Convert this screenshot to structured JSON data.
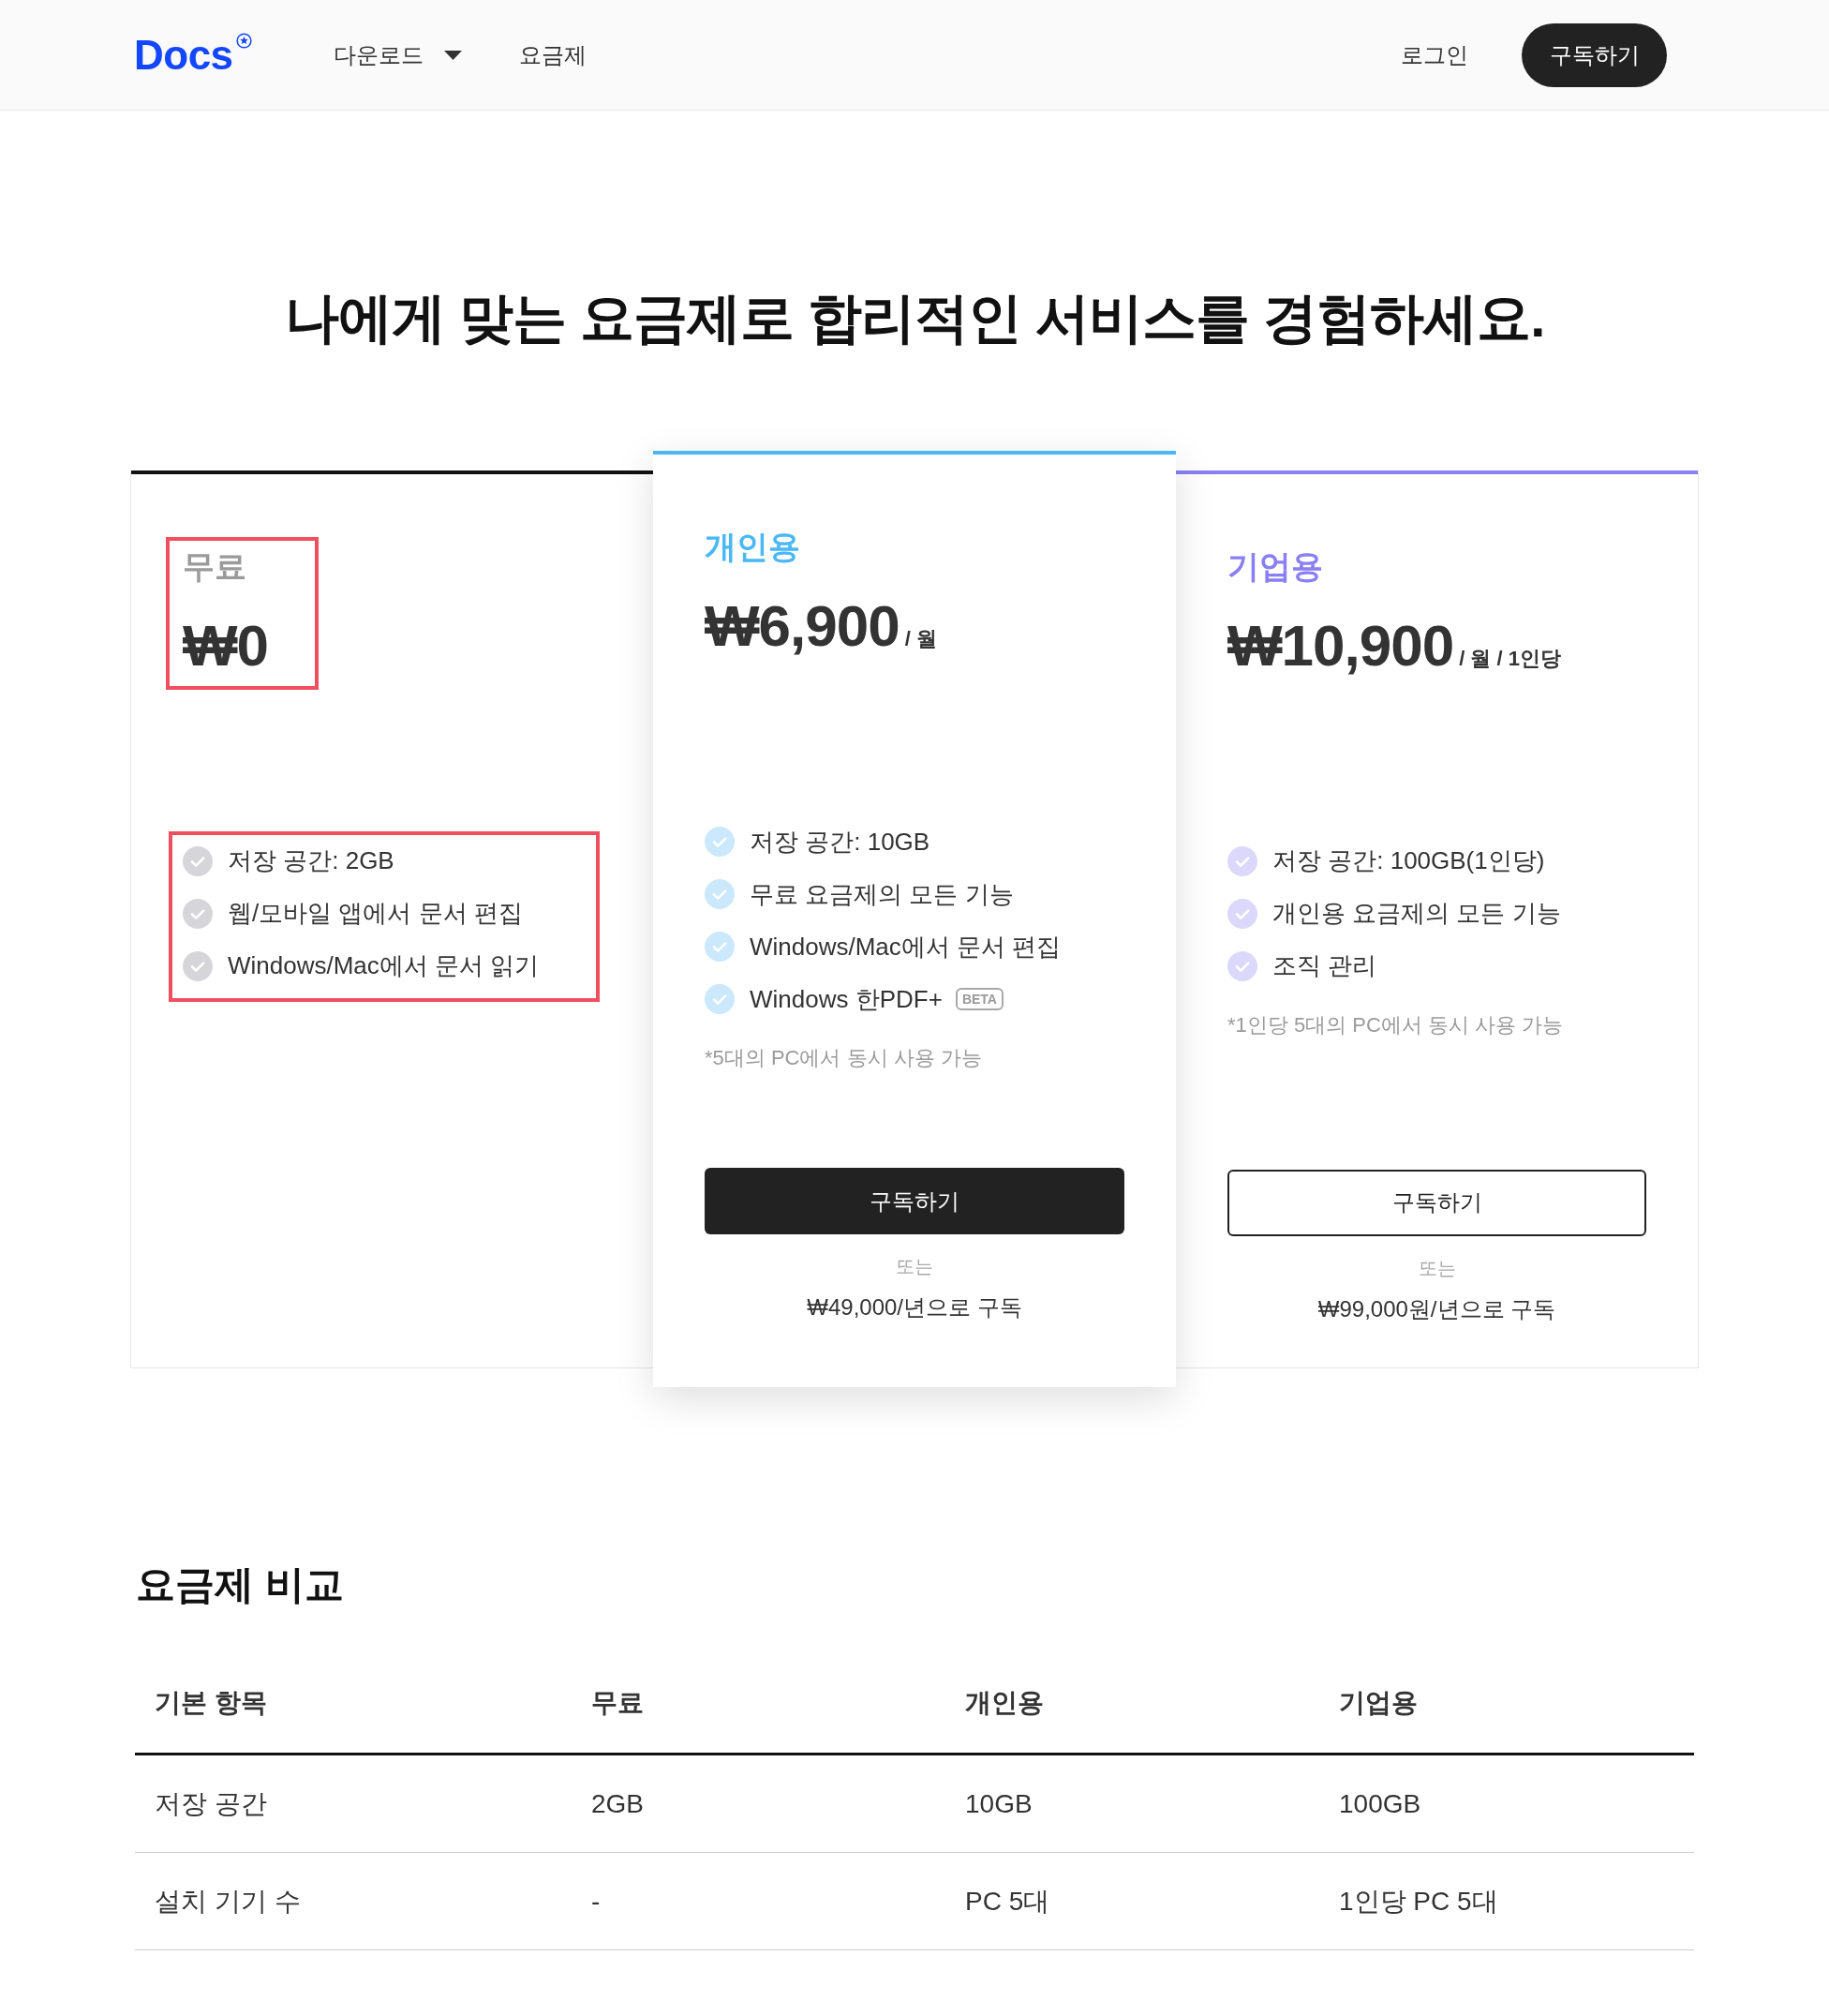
{
  "header": {
    "logo": "Docs",
    "nav": [
      {
        "label": "다운로드",
        "dropdown": true
      },
      {
        "label": "요금제",
        "dropdown": false
      }
    ],
    "login": "로그인",
    "subscribe": "구독하기"
  },
  "headline": "나에게 맞는 요금제로 합리적인 서비스를 경험하세요.",
  "plans": [
    {
      "kind": "free",
      "color": "#111111",
      "name": "무료",
      "price": "₩0",
      "header_highlighted": true,
      "features_highlighted": true,
      "features": [
        {
          "text": "저장 공간: 2GB"
        },
        {
          "text": "웹/모바일 앱에서 문서 편집"
        },
        {
          "text": "Windows/Mac에서 문서 읽기"
        }
      ]
    },
    {
      "kind": "personal",
      "color": "#4ab8f6",
      "name": "개인용",
      "price": "₩6,900",
      "price_unit": "/ 월",
      "header_highlighted": false,
      "features_highlighted": false,
      "features": [
        {
          "text": "저장 공간: 10GB"
        },
        {
          "text": "무료 요금제의 모든 기능"
        },
        {
          "text": "Windows/Mac에서 문서 편집"
        },
        {
          "text": "Windows 한PDF+",
          "badge": "BETA"
        }
      ],
      "note": "*5대의 PC에서 동시 사용 가능",
      "button": "구독하기",
      "or": "또는",
      "annual": "₩49,000/년으로 구독"
    },
    {
      "kind": "business",
      "color": "#8a7ff3",
      "name": "기업용",
      "price": "₩10,900",
      "price_unit": "/ 월 / 1인당",
      "header_highlighted": false,
      "features_highlighted": false,
      "features": [
        {
          "text": "저장 공간: 100GB(1인당)"
        },
        {
          "text": "개인용 요금제의 모든 기능"
        },
        {
          "text": "조직 관리"
        }
      ],
      "note": "*1인당 5대의 PC에서 동시 사용 가능",
      "button": "구독하기",
      "or": "또는",
      "annual": "₩99,000원/년으로 구독"
    }
  ],
  "comparison": {
    "title": "요금제 비교",
    "columns": [
      "기본 항목",
      "무료",
      "개인용",
      "기업용"
    ],
    "rows": [
      [
        "저장 공간",
        "2GB",
        "10GB",
        "100GB"
      ],
      [
        "설치 기기 수",
        "-",
        "PC 5대",
        "1인당 PC 5대"
      ]
    ]
  }
}
